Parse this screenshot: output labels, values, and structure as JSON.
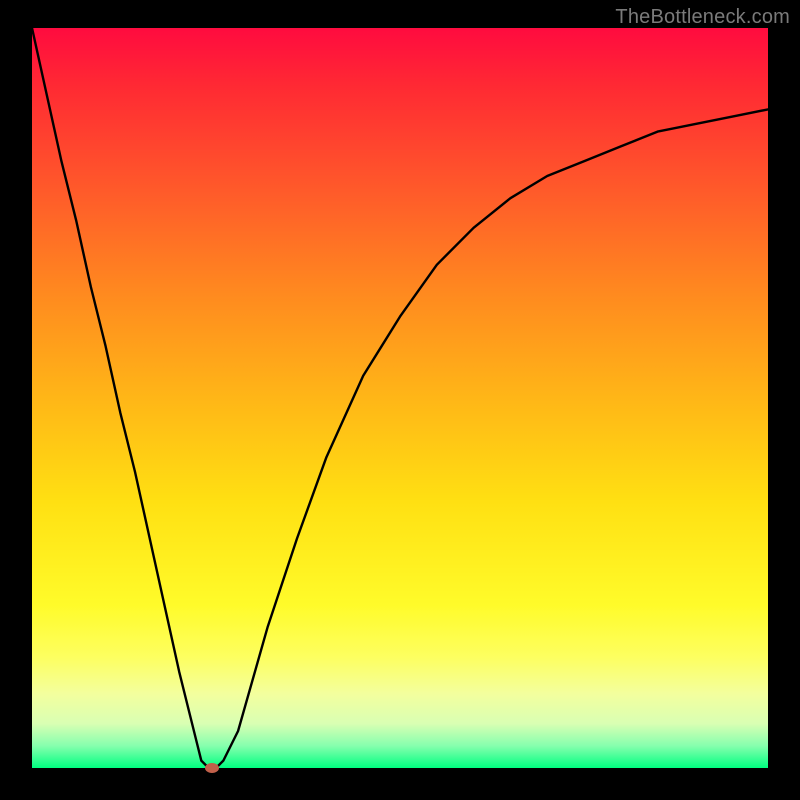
{
  "watermark": "TheBottleneck.com",
  "chart_data": {
    "type": "line",
    "title": "",
    "xlabel": "",
    "ylabel": "",
    "xlim": [
      0,
      100
    ],
    "ylim": [
      0,
      100
    ],
    "grid": false,
    "series": [
      {
        "name": "curve",
        "x": [
          0,
          2,
          4,
          6,
          8,
          10,
          12,
          14,
          16,
          18,
          20,
          22,
          23,
          24,
          25,
          26,
          28,
          30,
          32,
          36,
          40,
          45,
          50,
          55,
          60,
          65,
          70,
          75,
          80,
          85,
          90,
          95,
          100
        ],
        "y": [
          100,
          91,
          82,
          74,
          65,
          57,
          48,
          40,
          31,
          22,
          13,
          5,
          1,
          0,
          0,
          1,
          5,
          12,
          19,
          31,
          42,
          53,
          61,
          68,
          73,
          77,
          80,
          82,
          84,
          86,
          87,
          88,
          89
        ]
      }
    ],
    "marker": {
      "x": 24.5,
      "y": 0
    },
    "background_gradient": {
      "top": "#ff0b3f",
      "mid1": "#ffb617",
      "mid2": "#fffb2a",
      "bottom": "#00ff80"
    }
  }
}
